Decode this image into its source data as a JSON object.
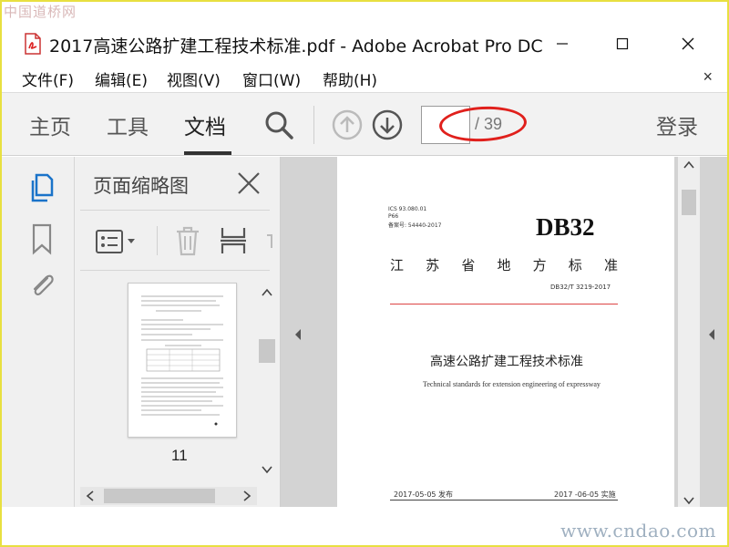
{
  "watermark": {
    "top": "中国道桥网",
    "bottom": "www.cndao.com"
  },
  "window": {
    "title": "2017高速公路扩建工程技术标准.pdf - Adobe Acrobat Pro DC",
    "controls": {
      "minimize": "─",
      "maximize": "☐",
      "close": "✕"
    }
  },
  "menu": {
    "items": [
      {
        "label": "文件(F)"
      },
      {
        "label": "编辑(E)"
      },
      {
        "label": "视图(V)"
      },
      {
        "label": "窗口(W)"
      },
      {
        "label": "帮助(H)"
      }
    ],
    "close": "×"
  },
  "toolbar": {
    "tabs": [
      {
        "label": "主页",
        "active": false
      },
      {
        "label": "工具",
        "active": false
      },
      {
        "label": "文档",
        "active": true
      }
    ],
    "page_input": "",
    "page_total": "/ 39",
    "login": "登录"
  },
  "sidebar": {
    "icons": [
      "pages-icon",
      "bookmark-icon",
      "attachment-icon"
    ]
  },
  "thumbnails": {
    "title": "页面缩略图",
    "current_page_label": "11"
  },
  "document": {
    "meta_lines": [
      "ICS 93.080.01",
      "P66",
      "备案号: 54440-2017"
    ],
    "standard": "DB32",
    "province": [
      "江",
      "苏",
      "省",
      "地",
      "方",
      "标",
      "准"
    ],
    "code": "DB32/T 3219-2017",
    "title_cn": "高速公路扩建工程技术标准",
    "title_en": "Technical standards for extension engineering of expressway",
    "issued": "2017-05-05 发布",
    "implemented": "2017 -06-05 实施"
  },
  "colors": {
    "frame": "#e8e040",
    "highlight": "#e0201c",
    "toolbar_bg": "#f2f2f2",
    "panel_bg": "#f0f0f0",
    "workspace_bg": "#d3d3d3"
  }
}
